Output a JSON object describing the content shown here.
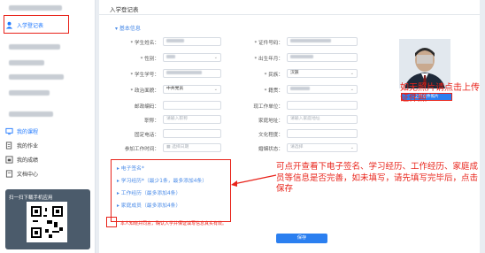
{
  "page": {
    "tab_title": "入学登记表"
  },
  "sidebar": {
    "active_item": "入学登记表",
    "items": [
      {
        "label": "我的课程"
      },
      {
        "label": "我的作业"
      },
      {
        "label": "我的成绩"
      },
      {
        "label": "文档中心"
      }
    ],
    "qr_title": "扫一扫下载手机应用"
  },
  "form": {
    "section_title": "基本信息",
    "fields": {
      "name": {
        "label": "* 学生姓名：",
        "value": ""
      },
      "gender": {
        "label": "* 性别：",
        "value": ""
      },
      "student_no": {
        "label": "* 学生学号：",
        "value": ""
      },
      "political": {
        "label": "* 政治面貌：",
        "value": "中共党员"
      },
      "postcode": {
        "label": "邮政编码：",
        "value": ""
      },
      "title": {
        "label": "职称：",
        "value": "",
        "placeholder": "请输入职称"
      },
      "phone": {
        "label": "固定电话：",
        "value": ""
      },
      "work_time": {
        "label": "参加工作时间：",
        "placeholder": "选择日期"
      },
      "id_no": {
        "label": "* 证件号码：",
        "value": ""
      },
      "birth": {
        "label": "* 出生年月：",
        "value": ""
      },
      "ethnic": {
        "label": "* 民族：",
        "value": "汉族"
      },
      "native": {
        "label": "* 籍贯：",
        "value": ""
      },
      "employer": {
        "label": "现工作单位：",
        "value": ""
      },
      "address": {
        "label": "家庭地址：",
        "placeholder": "请输入家庭地址"
      },
      "education": {
        "label": "文化程度：",
        "value": ""
      },
      "marital": {
        "label": "婚姻状态：",
        "placeholder": "请选择"
      }
    },
    "upload_label": "上传证件照片",
    "links": [
      {
        "label": "电子签名*",
        "hint": ""
      },
      {
        "label": "学习经历*",
        "hint": "（最少1条，最多添加4条）"
      },
      {
        "label": "工作经历",
        "hint": "（最多添加4条）"
      },
      {
        "label": "家庭成员",
        "hint": "（最多添加4条）"
      }
    ],
    "agree_text": "本人知晓并同意，确认入学并保证填写信息真实有效。",
    "save_label": "保存"
  },
  "annotations": {
    "photo_note": "如无照片请点击上传证件照",
    "info_note": "可点开查看下电子签名、学习经历、工作经历、家庭成员等信息是否完善，如未填写，请先填写完毕后，点击保存"
  },
  "colors": {
    "accent": "#2b7ff0",
    "annotation": "#e8231a",
    "link": "#4a8be8"
  }
}
